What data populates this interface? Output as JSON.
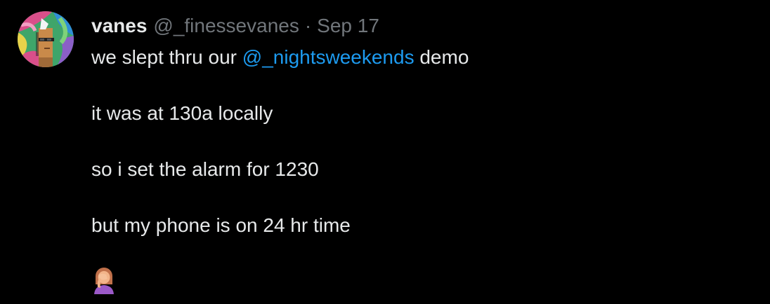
{
  "tweet": {
    "author": {
      "display_name": "vanes",
      "handle": "@_finessevanes",
      "avatar_icon": "pixel-punk-avatar-icon"
    },
    "separator": "·",
    "date": "Sep 17",
    "text": {
      "line1_before": "we slept thru our ",
      "line1_mention": "@_nightsweekends",
      "line1_after": " demo",
      "line2": "it was at 130a locally",
      "line3": "so i set the alarm for 1230",
      "line4": "but my phone is on 24 hr time"
    },
    "emoji_icon": "face-palm-woman-icon"
  },
  "colors": {
    "background": "#000000",
    "text": "#e7e9ea",
    "muted": "#71767b",
    "link": "#1d9bf0"
  }
}
